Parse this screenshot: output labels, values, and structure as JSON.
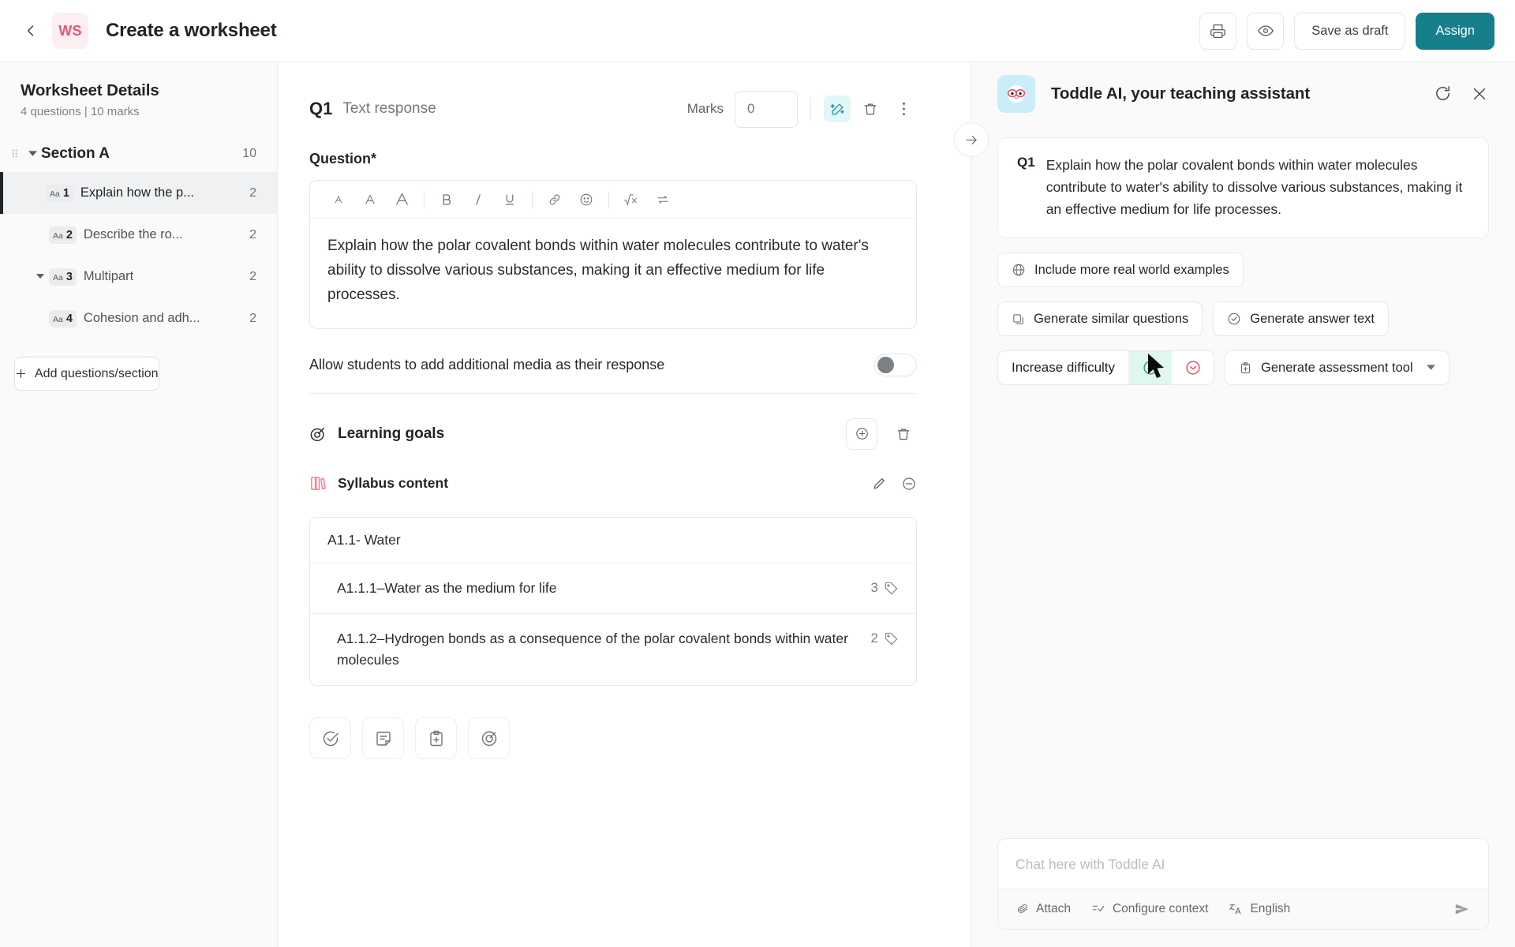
{
  "header": {
    "back_icon": "chevron-left-icon",
    "badge": "WS",
    "title": "Create a worksheet",
    "print_icon": "print-icon",
    "preview_icon": "eye-icon",
    "save_draft_label": "Save as draft",
    "assign_label": "Assign",
    "accent_color": "#15808c",
    "badge_color": "#e05975"
  },
  "sidebar": {
    "title": "Worksheet Details",
    "subtitle": "4 questions | 10 marks",
    "section": {
      "name": "Section A",
      "marks": "10"
    },
    "questions": [
      {
        "type": "Aa",
        "num": "1",
        "label": "Explain how the p...",
        "marks": "2",
        "selected": true,
        "has_caret": false
      },
      {
        "type": "Aa",
        "num": "2",
        "label": "Describe the ro...",
        "marks": "2",
        "selected": false,
        "has_caret": false
      },
      {
        "type": "Aa",
        "num": "3",
        "label": "Multipart",
        "marks": "2",
        "selected": false,
        "has_caret": true
      },
      {
        "type": "Aa",
        "num": "4",
        "label": "Cohesion and adh...",
        "marks": "2",
        "selected": false,
        "has_caret": false
      }
    ],
    "add_label": "Add questions/section"
  },
  "question": {
    "number": "Q1",
    "type_label": "Text response",
    "marks_label": "Marks",
    "marks_value": "",
    "marks_placeholder": "0",
    "field_label": "Question*",
    "text": "Explain how the polar covalent bonds within water molecules contribute to water's ability to dissolve various substances, making it an effective medium for life processes.",
    "toolbar": [
      "text-size-small-icon",
      "text-size-medium-icon",
      "text-size-large-icon",
      "bold-icon",
      "italic-icon",
      "underline-icon",
      "link-icon",
      "emoji-icon",
      "formula-icon",
      "equilibrium-arrows-icon"
    ],
    "allow_media_label": "Allow students to add additional media as their response",
    "allow_media_on": false
  },
  "learning_goals": {
    "title": "Learning goals",
    "icon": "target-icon",
    "add_icon": "plus-circle-icon",
    "delete_icon": "trash-icon",
    "syllabus": {
      "title": "Syllabus content",
      "icon": "books-icon",
      "edit_icon": "pencil-icon",
      "remove_icon": "minus-circle-icon",
      "header_row": "A1.1- Water",
      "rows": [
        {
          "text": "A1.1.1–Water as the medium for life",
          "count": "3"
        },
        {
          "text": "A1.1.2–Hydrogen bonds as a consequence of the polar covalent bonds within water  molecules",
          "count": "2"
        }
      ]
    }
  },
  "bottom_tools": [
    "check-circle-icon",
    "note-icon",
    "clipboard-plus-icon",
    "target-icon"
  ],
  "ai_panel": {
    "collapse_icon": "arrow-right-icon",
    "avatar": "toddle-ai-avatar",
    "title": "Toddle AI, your teaching assistant",
    "refresh_icon": "refresh-icon",
    "close_icon": "close-icon",
    "question_card": {
      "number": "Q1",
      "text": "Explain how the polar covalent bonds within water molecules contribute to water's ability to dissolve various substances, making it an effective medium for life processes."
    },
    "actions": [
      {
        "label": "Include more real world examples",
        "icon": "globe-icon"
      },
      {
        "label": "Generate similar questions",
        "icon": "copy-icon"
      },
      {
        "label": "Generate answer text",
        "icon": "check-circle-icon"
      }
    ],
    "difficulty": {
      "label": "Increase difficulty",
      "up_icon": "chevron-up-circle-icon",
      "down_icon": "chevron-down-circle-icon",
      "up_color": "#1f9d6b",
      "down_color": "#e0435f",
      "up_highlight": "#dff7ec"
    },
    "assessment_tool": {
      "label": "Generate assessment tool",
      "icon": "clipboard-plus-icon",
      "caret": "chevron-down-icon"
    },
    "chat": {
      "placeholder": "Chat here with Toddle AI",
      "value": "",
      "attach_label": "Attach",
      "attach_icon": "attach-icon",
      "context_label": "Configure context",
      "context_icon": "list-check-icon",
      "language_label": "English",
      "language_icon": "translate-icon",
      "send_icon": "send-icon"
    }
  }
}
